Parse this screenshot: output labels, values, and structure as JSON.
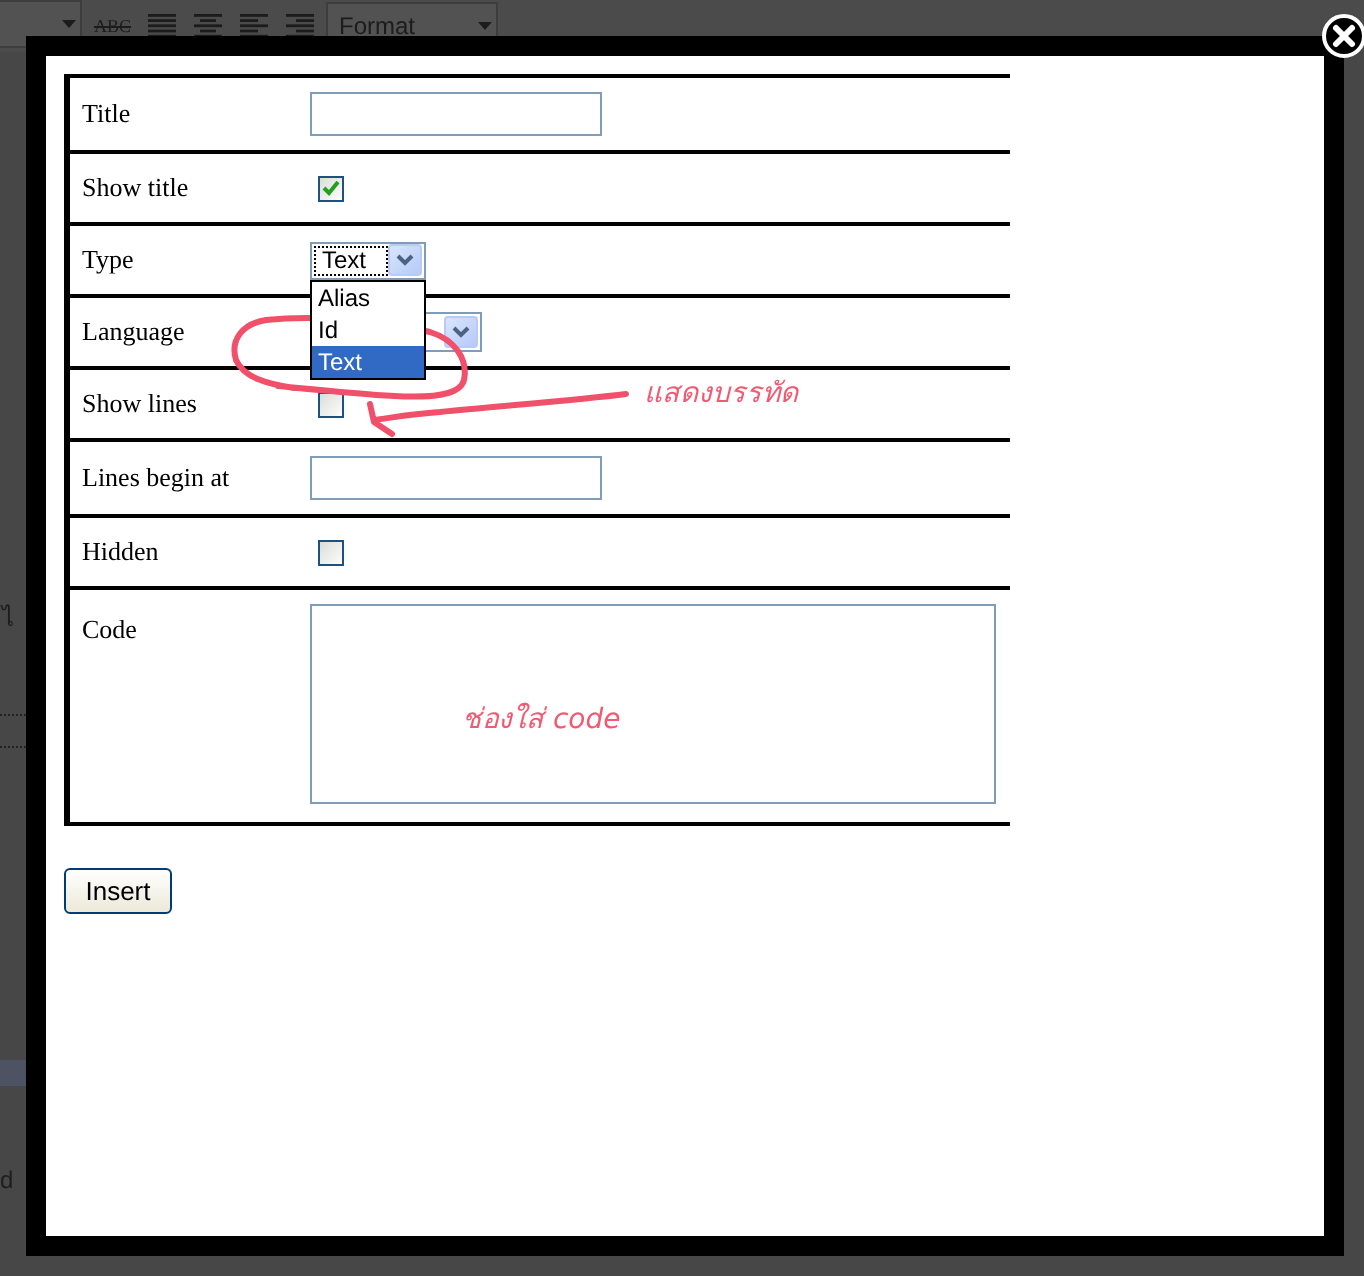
{
  "background": {
    "toolbar": {
      "strike_label": "ABC",
      "format_select": "Format"
    },
    "fragments": [
      "ไ",
      "d"
    ]
  },
  "dialog": {
    "fields": [
      {
        "kind": "text",
        "label": "Title"
      },
      {
        "kind": "checkbox",
        "label": "Show title",
        "checked": true
      },
      {
        "kind": "select",
        "label": "Type",
        "value": "Text",
        "open": true,
        "options": [
          {
            "label": "Alias",
            "selected": false
          },
          {
            "label": "Id",
            "selected": false
          },
          {
            "label": "Text",
            "selected": true
          }
        ]
      },
      {
        "kind": "select",
        "label": "Language",
        "open": false
      },
      {
        "kind": "checkbox",
        "label": "Show lines",
        "checked": false
      },
      {
        "kind": "text",
        "label": "Lines begin at"
      },
      {
        "kind": "checkbox",
        "label": "Hidden",
        "checked": false
      },
      {
        "kind": "textarea",
        "label": "Code"
      }
    ],
    "insert_button": "Insert"
  },
  "annotations": [
    {
      "kind": "arrow_note",
      "text": "แสดงบรรทัด"
    },
    {
      "kind": "note",
      "text": "ช่องใส่ code"
    }
  ]
}
